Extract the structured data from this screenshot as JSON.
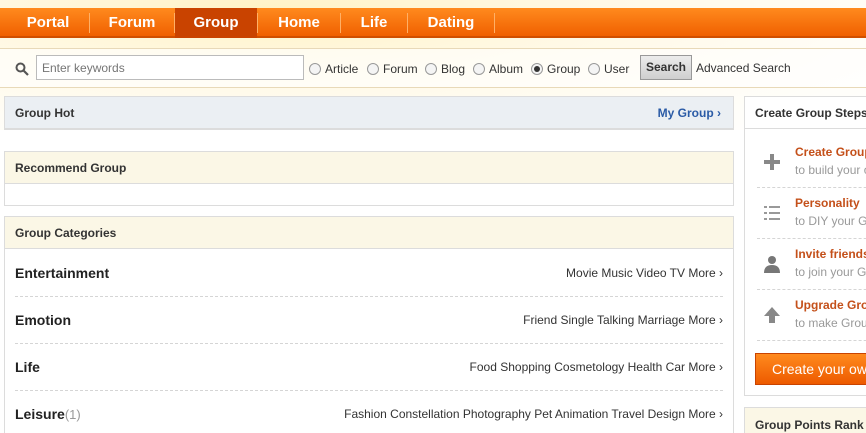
{
  "nav": {
    "items": [
      {
        "label": "Portal",
        "active": false
      },
      {
        "label": "Forum",
        "active": false
      },
      {
        "label": "Group",
        "active": true
      },
      {
        "label": "Home",
        "active": false
      },
      {
        "label": "Life",
        "active": false
      },
      {
        "label": "Dating",
        "active": false
      }
    ]
  },
  "search": {
    "placeholder": "Enter keywords",
    "options": [
      {
        "label": "Article",
        "checked": false
      },
      {
        "label": "Forum",
        "checked": false
      },
      {
        "label": "Blog",
        "checked": false
      },
      {
        "label": "Album",
        "checked": false
      },
      {
        "label": "Group",
        "checked": true
      },
      {
        "label": "User",
        "checked": false
      }
    ],
    "button_label": "Search",
    "advanced_label": "Advanced Search"
  },
  "group_hot": {
    "title": "Group Hot",
    "my_group_link": "My Group ›"
  },
  "recommend": {
    "title": "Recommend Group"
  },
  "categories": {
    "title": "Group Categories",
    "rows": [
      {
        "name": "Entertainment",
        "count": "",
        "links": "Movie Music Video TV More ›"
      },
      {
        "name": "Emotion",
        "count": "",
        "links": "Friend Single Talking Marriage More ›"
      },
      {
        "name": "Life",
        "count": "",
        "links": "Food Shopping Cosmetology Health Car More ›"
      },
      {
        "name": "Leisure",
        "count": "(1)",
        "links": "Fashion Constellation Photography Pet Animation Travel Design More ›"
      }
    ]
  },
  "steps_panel": {
    "title": "Create Group Steps",
    "steps": [
      {
        "icon": "plus-icon",
        "title": "Create Group",
        "desc": "to build your own"
      },
      {
        "icon": "list-icon",
        "title": "Personality",
        "desc": "to DIY your Group"
      },
      {
        "icon": "user-icon",
        "title": "Invite friends",
        "desc": "to join your Group"
      },
      {
        "icon": "arrow-up-icon",
        "title": "Upgrade Group",
        "desc": "to make Group"
      }
    ],
    "create_button": "Create your own"
  },
  "rank_panel": {
    "title": "Group Points Rank"
  },
  "colors": {
    "accent": "#f06000",
    "link": "#2b5ba6",
    "step_title": "#c4501a"
  }
}
